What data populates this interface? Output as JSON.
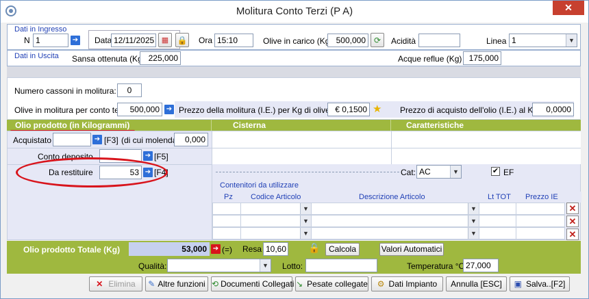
{
  "window": {
    "title": "Molitura Conto Terzi (P                          A)"
  },
  "ingresso": {
    "section_label": "Dati in Ingresso",
    "n_label": "N",
    "n_value": "1",
    "data_label": "Data",
    "data_value": "12/11/2025",
    "ora_label": "Ora",
    "ora_value": "15:10",
    "olive_label": "Olive in carico (Kg)",
    "olive_value": "500,000",
    "acidita_label": "Acidità",
    "acidita_value": "",
    "linea_label": "Linea",
    "linea_value": "1"
  },
  "uscita": {
    "section_label": "Dati in Uscita",
    "sansa_label": "Sansa ottenuta (Kg)",
    "sansa_value": "225,000",
    "acque_label": "Acque reflue (Kg)",
    "acque_value": "175,000"
  },
  "molitura": {
    "cassoni_label": "Numero cassoni in molitura:",
    "cassoni_value": "0",
    "olive_ct_label": "Olive in molitura per conto terzi:",
    "olive_ct_value": "500,000",
    "prezzo_label": "Prezzo della molitura (I.E.) per Kg di olive",
    "prezzo_value": "€ 0,1500",
    "acquisto_label": "Prezzo di acquisto dell'olio (I.E.) al Kg",
    "acquisto_value": "0,0000"
  },
  "olio": {
    "header": "Olio prodotto (in Kilogrammi)",
    "cisterna_header": "Cisterna",
    "caratteristiche_header": "Caratteristiche",
    "acquistato_label": "Acquistato",
    "acquistato_value": "",
    "f3_label": "[F3]",
    "molenda_label": "(di cui molenda)",
    "molenda_value": "0,000",
    "deposito_label": "Conto deposito",
    "deposito_value": "",
    "f5_label": "[F5]",
    "restituire_label": "Da restituire",
    "restituire_value": "53",
    "f4_label": "[F4]",
    "cat_label": "Cat:",
    "cat_value": "AC",
    "ef_label": "EF"
  },
  "contenitori": {
    "label": "Contenitori da utilizzare",
    "columns": [
      "Pz",
      "Codice Articolo",
      "Descrizione Articolo",
      "Lt TOT",
      "Prezzo IE"
    ]
  },
  "totale": {
    "label": "Olio prodotto Totale (Kg)",
    "value": "53,000",
    "eq_label": "(=)",
    "resa_label": "Resa",
    "resa_value": "10,60",
    "calcola": "Calcola",
    "valori": "Valori Automatici",
    "qualita_label": "Qualità:",
    "qualita_value": "",
    "lotto_label": "Lotto:",
    "lotto_value": "",
    "temp_label": "Temperatura °C",
    "temp_value": "27,000"
  },
  "footer": {
    "elimina": "Elimina",
    "altre": "Altre funzioni",
    "documenti": "Documenti Collegati",
    "pesate": "Pesate collegate",
    "impianto": "Dati Impianto",
    "annulla": "Annulla [ESC]",
    "salva": "Salva..[F2]"
  },
  "colors": {
    "accent_green": "#9fb83f",
    "annotation_red": "#d8141c",
    "link_blue": "#1f3fb5"
  }
}
